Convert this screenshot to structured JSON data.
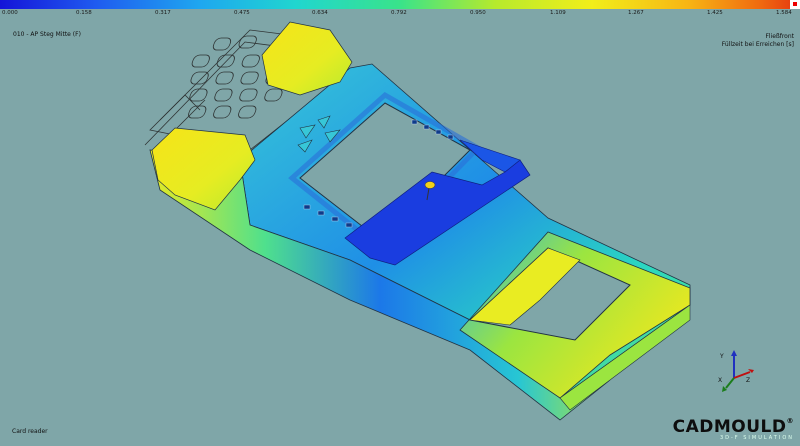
{
  "colorbar": {
    "ticks": [
      "0.000",
      "0.158",
      "0.317",
      "0.475",
      "0.634",
      "0.792",
      "0.950",
      "1.109",
      "1.267",
      "1.425",
      "1.584"
    ],
    "min_color": "#1414d8",
    "max_color": "#e33510"
  },
  "viewport": {
    "top_left_label": "010 - AP Steg Mitte (F)",
    "top_right_line1": "Fließfront",
    "top_right_line2": "Füllzeit bei Erreichen [s]",
    "bottom_left_label": "Card reader"
  },
  "logo": {
    "name": "CADMOULD",
    "tagline": "3D-F SIMULATION",
    "registered": "®"
  },
  "axis": {
    "x_label": "X",
    "y_label": "Y",
    "z_label": "Z",
    "x_color": "#1b7d1b",
    "y_color": "#2030c0",
    "z_color": "#c01010"
  }
}
